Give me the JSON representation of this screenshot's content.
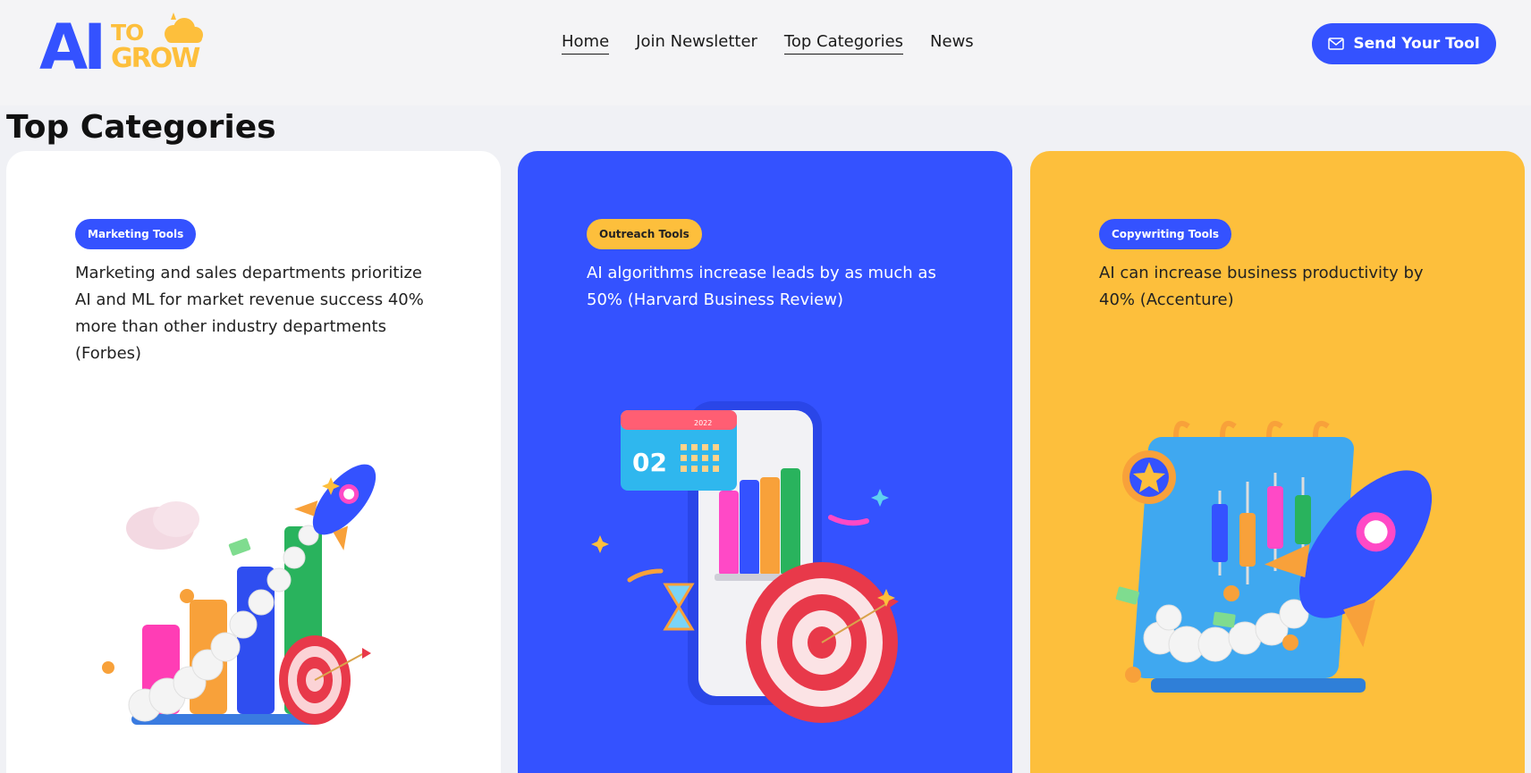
{
  "header": {
    "logo": {
      "main": "AI",
      "top": "TO",
      "bottom": "GROW"
    },
    "nav": [
      "Home",
      "Join Newsletter",
      "Top Categories",
      "News"
    ],
    "cta_label": "Send Your Tool"
  },
  "section": {
    "title": "Top Categories"
  },
  "cards": [
    {
      "badge": "Marketing Tools",
      "text": "Marketing and sales departments prioritize AI and ML for market revenue success 40% more than other industry departments (Forbes)"
    },
    {
      "badge": "Outreach Tools",
      "text": "AI algorithms increase leads by as much as 50% (Harvard Business Review)"
    },
    {
      "badge": "Copywriting Tools",
      "text": "AI can increase business productivity by 40% (Accenture)"
    }
  ],
  "illustrations": {
    "calendar_day": "02",
    "calendar_year": "2022"
  }
}
